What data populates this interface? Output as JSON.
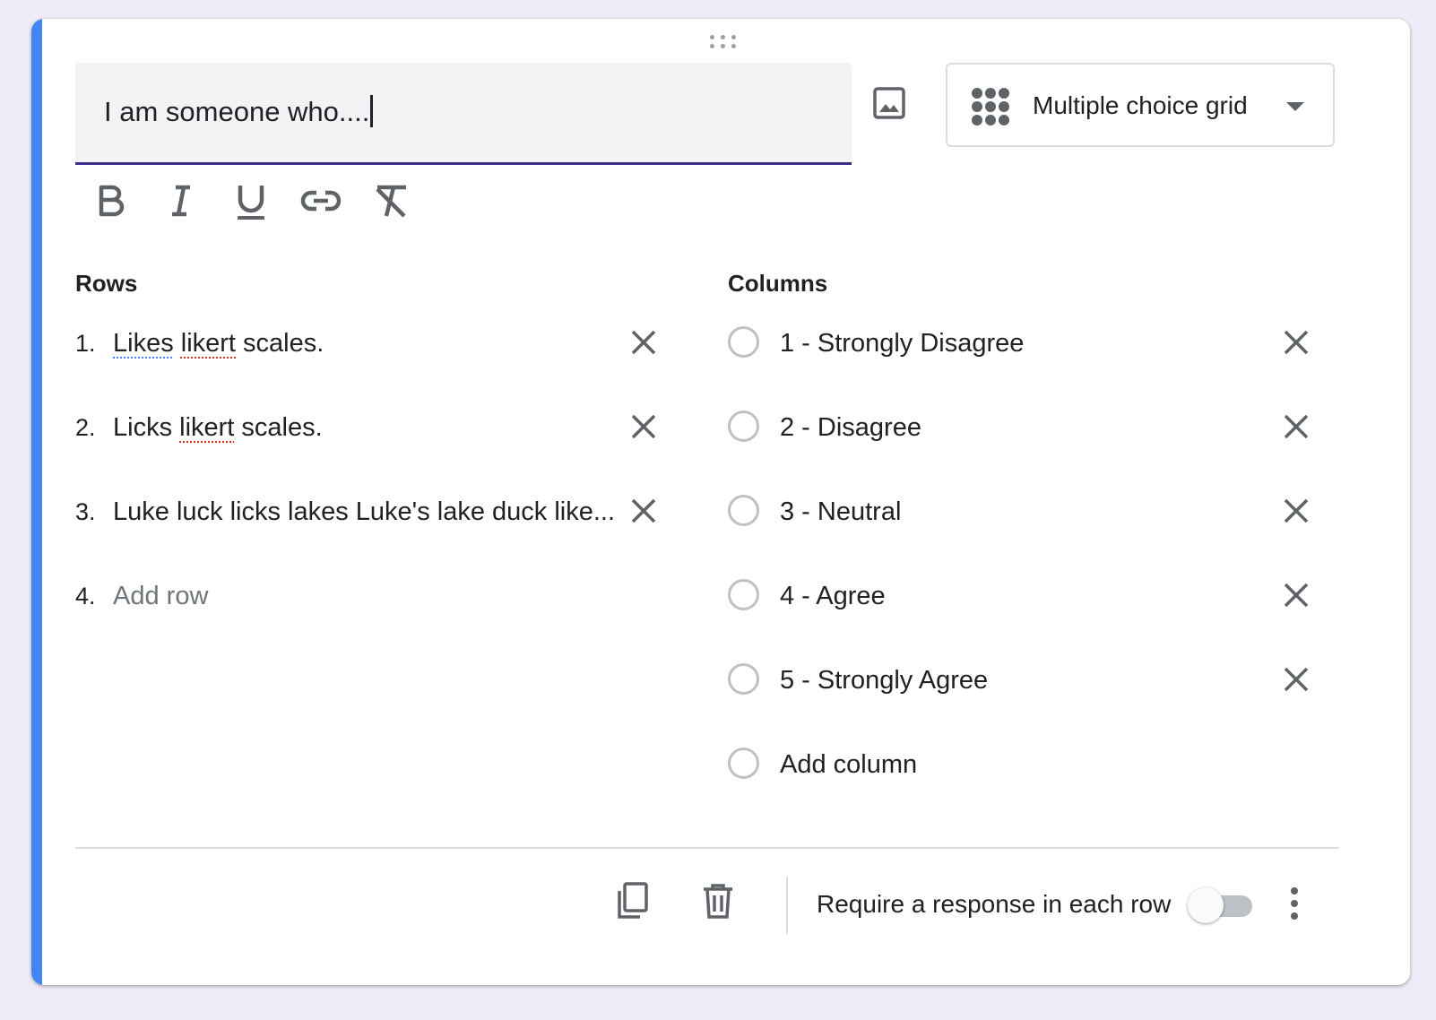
{
  "question": {
    "title_value": "I am someone who....",
    "type_label": "Multiple choice grid"
  },
  "icons": {
    "drag": "drag-handle-icon",
    "image": "image-icon",
    "grid": "grid-icon",
    "dropdown": "dropdown-arrow-icon",
    "bold": "bold-icon",
    "italic": "italic-icon",
    "underline": "underline-icon",
    "link": "link-icon",
    "clear_format": "clear-formatting-icon",
    "remove": "close-icon",
    "duplicate": "copy-icon",
    "delete": "trash-icon",
    "more": "more-vert-icon"
  },
  "rows": {
    "label": "Rows",
    "items": [
      {
        "num": "1.",
        "text_parts": [
          "Likes",
          " ",
          "likert",
          " scales."
        ]
      },
      {
        "num": "2.",
        "text_parts": [
          "Licks ",
          "likert",
          " scales."
        ]
      },
      {
        "num": "3.",
        "text": "Luke luck licks lakes Luke's lake duck like..."
      }
    ],
    "add": {
      "num": "4.",
      "placeholder": "Add row"
    }
  },
  "columns": {
    "label": "Columns",
    "items": [
      "1 - Strongly Disagree",
      "2 - Disagree",
      "3 - Neutral",
      "4 - Agree",
      "5 - Strongly Agree"
    ],
    "add_placeholder": "Add column"
  },
  "footer": {
    "require_label": "Require a response in each row",
    "require_on": false
  },
  "colors": {
    "accent": "#4285f4",
    "focus_underline": "#3f2d89",
    "background": "#f0ebf8"
  }
}
